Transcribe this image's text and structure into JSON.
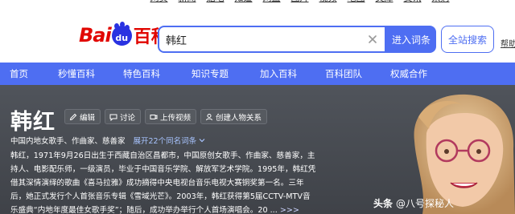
{
  "top_nav": {
    "items": [
      "网页",
      "新闻",
      "贴吧",
      "知道",
      "网盘",
      "图片",
      "视频",
      "地图",
      "文库",
      "资讯",
      "采购"
    ]
  },
  "brand": {
    "logo_prefix": "Bai",
    "logo_paw": "du",
    "logo_suffix": "百科",
    "logo_red": "#e10601",
    "logo_blue": "#2932e1"
  },
  "search": {
    "value": "韩红",
    "enter_entry_label": "进入词条",
    "search_all_label": "全站搜索",
    "help_label": "帮助",
    "accent": "#4e6ef2"
  },
  "main_nav": {
    "items": [
      "首页",
      "秒懂百科",
      "特色百科",
      "知识专题",
      "加入百科",
      "百科团队",
      "权威合作"
    ]
  },
  "entry": {
    "title": "韩红",
    "actions": [
      {
        "label": "编辑",
        "icon": "pencil-icon"
      },
      {
        "label": "讨论",
        "icon": "chat-icon"
      },
      {
        "label": "上传视频",
        "icon": "video-upload-icon"
      },
      {
        "label": "创建人物关系",
        "icon": "relation-icon"
      }
    ],
    "description": "中国内地女歌手、作曲家、慈善家",
    "homonym_link": "展开22个同名词条",
    "summary": "韩红，1971年9月26日出生于西藏自治区昌都市，中国原创女歌手、作曲家、慈善家，主持人、电影配乐师，一级演员，毕业于中国音乐学院、解放军艺术学院。1995年，韩红凭借其深情演绎的歌曲《喜马拉雅》成功摘得中央电视台音乐电视大赛铜奖第一名。三年后，她正式发行个人首张音乐专辑《雪域光芒》。2003年，韩红获得第5届CCTV-MTV音乐盛典“内地年度最佳女歌手奖”；随后，成功举办举行个人首场演唱会。20 ...",
    "summary_more": ">>>"
  },
  "watermark": {
    "brand": "头条",
    "handle": "@八号探秘人"
  }
}
